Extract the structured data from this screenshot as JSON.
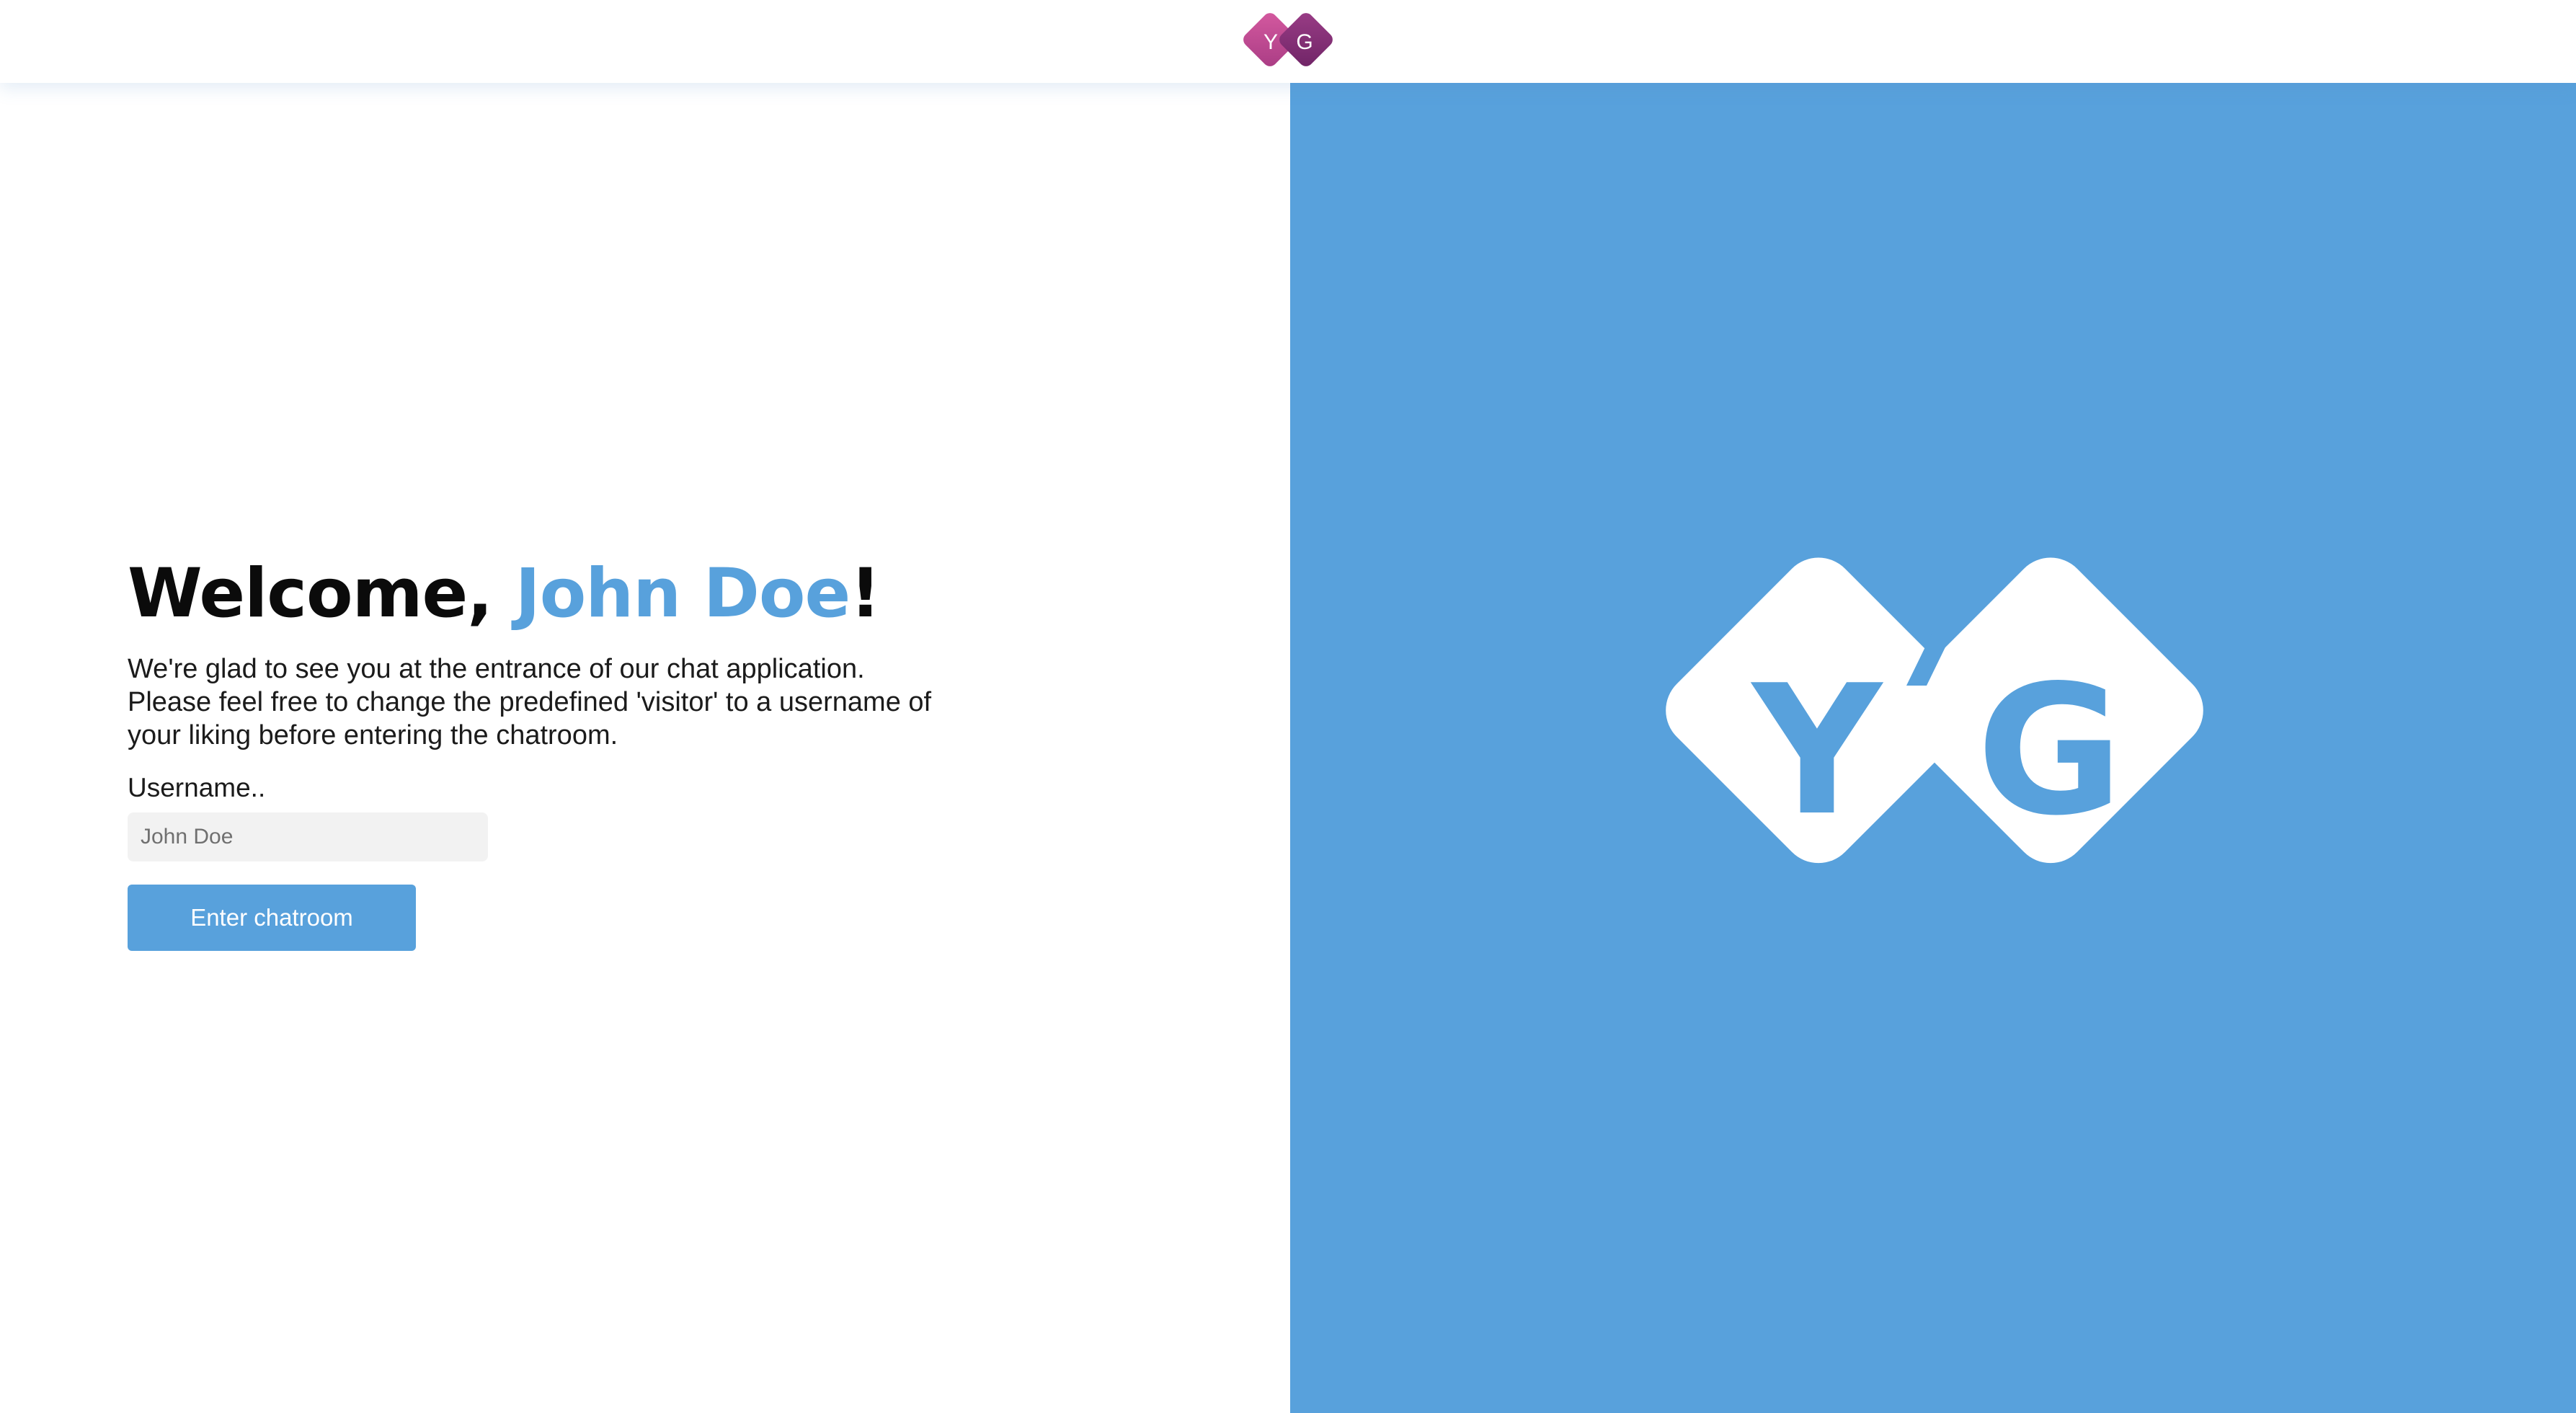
{
  "header": {
    "logo": {
      "letter_left": "Y",
      "letter_right": "G",
      "color_light": "#c24f93",
      "color_dark": "#8a2b72"
    }
  },
  "main": {
    "welcome_prefix": "Welcome, ",
    "welcome_name": "John Doe",
    "welcome_suffix": "!",
    "intro_lines": [
      "We're glad to see you at the entrance of our chat application.",
      "Please feel free to change the predefined 'visitor' to a username of",
      "your liking before entering the chatroom."
    ],
    "username_label": "Username..",
    "username_placeholder": "John Doe",
    "username_value": "",
    "enter_button_label": "Enter chatroom"
  },
  "hero": {
    "letter_left": "Y",
    "letter_right": "G",
    "background": "#58a1dc",
    "shape_color": "#ffffff"
  },
  "colors": {
    "accent": "#58a1dc",
    "text": "#0b0b0b",
    "input_background": "#f2f2f2"
  }
}
